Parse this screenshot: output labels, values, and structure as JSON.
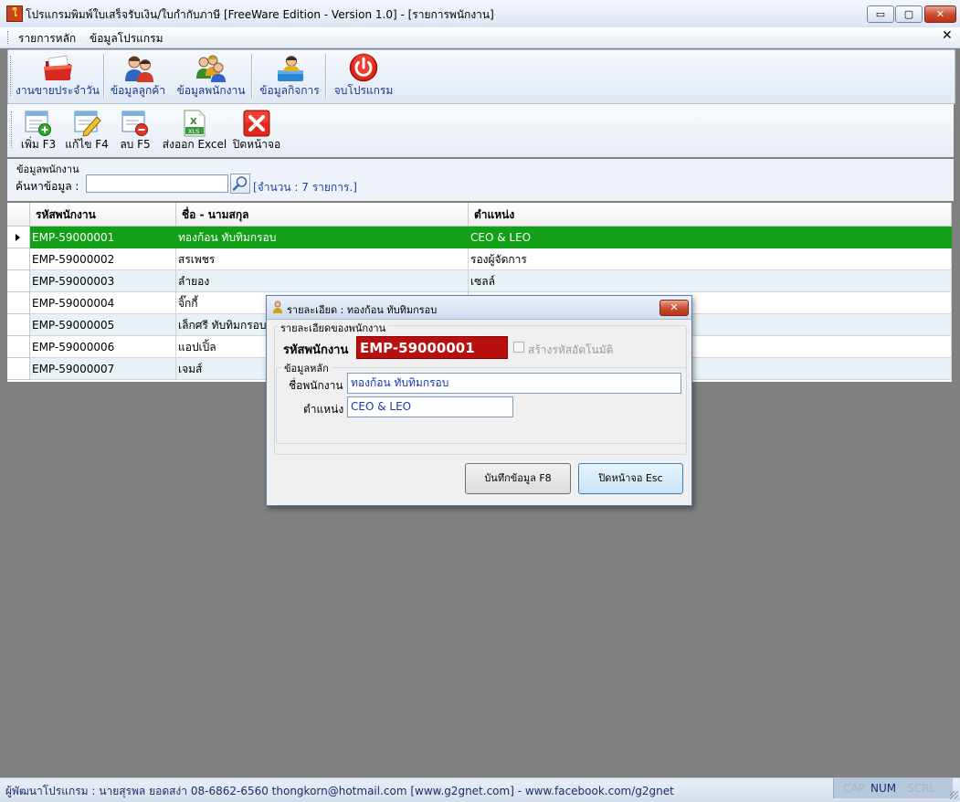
{
  "window": {
    "title": "โปรแกรมพิมพ์ใบเสร็จรับเงิน/ใบกำกับภาษี [FreeWare Edition - Version 1.0] - [รายการพนักงาน]",
    "minimize_glyph": "▭",
    "maximize_glyph": "▢",
    "close_glyph": "✕",
    "app_icon_glyph": "ใ"
  },
  "menu": {
    "items": [
      "รายการหลัก",
      "ข้อมูลโปรแกรม"
    ],
    "close_glyph": "✕"
  },
  "toolbar1": {
    "buttons": [
      {
        "label": "งานขายประจำวัน",
        "icon": "folder-icon"
      },
      {
        "label": "ข้อมูลลูกค้า",
        "icon": "customers-icon"
      },
      {
        "label": "ข้อมูลพนักงาน",
        "icon": "employees-icon"
      },
      {
        "label": "ข้อมูลกิจการ",
        "icon": "business-icon"
      },
      {
        "label": "จบโปรแกรม",
        "icon": "power-icon"
      }
    ]
  },
  "toolbar2": {
    "buttons": [
      {
        "label": "เพิ่ม F3",
        "icon": "add-record-icon"
      },
      {
        "label": "แก้ไข F4",
        "icon": "edit-record-icon"
      },
      {
        "label": "ลบ F5",
        "icon": "delete-record-icon"
      },
      {
        "label": "ส่งออก Excel",
        "icon": "excel-icon"
      },
      {
        "label": "ปิดหน้าจอ",
        "icon": "close-screen-icon"
      }
    ]
  },
  "search": {
    "group_caption": "ข้อมูลพนักงาน",
    "label": "ค้นหาข้อมูล :",
    "value": "",
    "count_text": "[จำนวน : 7 รายการ.]"
  },
  "grid": {
    "columns": [
      "รหัสพนักงาน",
      "ชื่อ - นามสกุล",
      "ตำแหน่ง"
    ],
    "rows": [
      [
        "EMP-59000001",
        "ทองก้อน ทับทิมกรอบ",
        "CEO & LEO"
      ],
      [
        "EMP-59000002",
        "สรเพชร",
        "รองผู้จัดการ"
      ],
      [
        "EMP-59000003",
        "ลำยอง",
        "เซลล์"
      ],
      [
        "EMP-59000004",
        "จิ๊กกี้",
        ""
      ],
      [
        "EMP-59000005",
        "เล็กศรี ทับทิมกรอบ",
        ""
      ],
      [
        "EMP-59000006",
        "แอปเปิ้ล",
        ""
      ],
      [
        "EMP-59000007",
        "เจมส์",
        ""
      ]
    ],
    "selected_row": 0
  },
  "dialog": {
    "title": "รายละเอียด : ทองก้อน ทับทิมกรอบ",
    "close_glyph": "✕",
    "outer_legend": "รายละเอียดของพนักงาน",
    "code_label": "รหัสพนักงาน",
    "code_value": "EMP-59000001",
    "auto_code_label": "สร้างรหัสอัตโนมัติ",
    "main_legend": "ข้อมูลหลัก",
    "name_label": "ชื่อพนักงาน",
    "name_value": "ทองก้อน ทับทิมกรอบ",
    "position_label": "ตำแหน่ง",
    "position_value": "CEO & LEO",
    "save_button": "บันทึกข้อมูล F8",
    "close_button": "ปิดหน้าจอ Esc"
  },
  "status": {
    "text": "ผู้พัฒนาโปรแกรม : นายสุรพล ยอดสง่า 08-6862-6560 thongkorn@hotmail.com [www.g2gnet.com] - www.facebook.com/g2gnet",
    "keys": [
      "CAP",
      "NUM",
      "SCRL"
    ]
  },
  "colors": {
    "selected_row": "#11a016",
    "code_field": "#b80f0f",
    "background": "#808080",
    "link_text": "#1b3fa8"
  }
}
